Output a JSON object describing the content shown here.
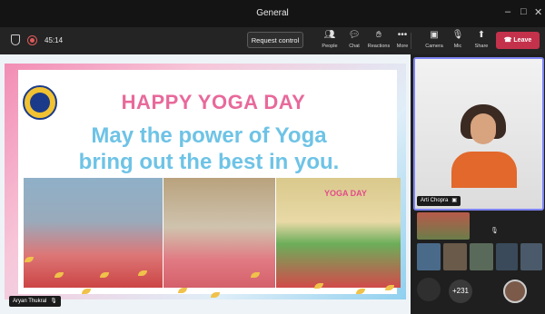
{
  "window": {
    "title": "General"
  },
  "toolbar": {
    "timer": "45:14",
    "request_control": "Request control",
    "people": "People",
    "chat": "Chat",
    "reactions": "Reactions",
    "more": "More",
    "camera": "Camera",
    "mic": "Mic",
    "share": "Share",
    "leave": "Leave"
  },
  "slide": {
    "headline": "HAPPY YOGA DAY",
    "message_line1": "May the power of Yoga",
    "message_line2": "bring out the best in you.",
    "photo3_banner": "YOGA DAY"
  },
  "presenter": {
    "name": "Aryan Thukral"
  },
  "participants": {
    "featured": {
      "name": "Arti Chopra"
    },
    "overflow": "+231"
  },
  "colors": {
    "accent": "#7f85f5",
    "leave": "#c4314b",
    "headline": "#e8699b",
    "message": "#6ec3e6"
  }
}
